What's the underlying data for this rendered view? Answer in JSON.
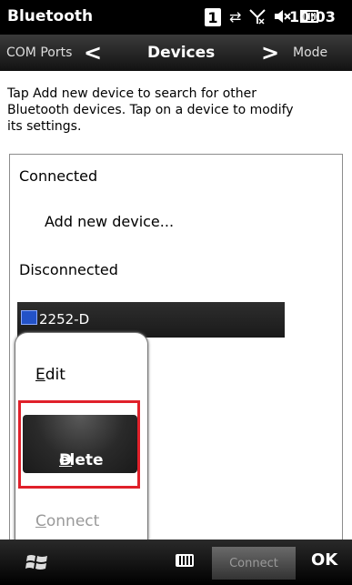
{
  "status_bar": {
    "title": "Bluetooth",
    "badge": "1",
    "icons": [
      "sync-arrows-icon",
      "no-signal-icon",
      "speaker-mute-icon",
      "battery-icon"
    ],
    "time": "10:03"
  },
  "tabs": {
    "prev": "COM Ports",
    "current": "Devices",
    "next": "Mode"
  },
  "content": {
    "instructions": "Tap Add new device to search for other Bluetooth devices. Tap on a device to modify its settings.",
    "list": {
      "connected_header": "Connected",
      "add_device": "Add new device...",
      "disconnected_header": "Disconnected",
      "device": "2252-D"
    }
  },
  "context_menu": {
    "items": [
      {
        "accel": "E",
        "rest": "dit",
        "enabled": true,
        "selected": false
      },
      {
        "accel": "D",
        "rest": "elete",
        "enabled": true,
        "selected": true
      },
      {
        "accel": "C",
        "rest": "onnect",
        "enabled": false,
        "selected": false
      }
    ]
  },
  "bottom_bar": {
    "center_softkey": "Connect",
    "right_softkey": "OK"
  },
  "colors": {
    "highlight_box": "#e0202a",
    "device_icon": "#2352c7"
  }
}
